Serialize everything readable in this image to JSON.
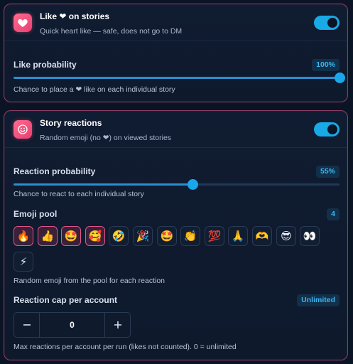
{
  "like_card": {
    "title": "Like ❤ on stories",
    "subtitle": "Quick heart like — safe, does not go to DM",
    "enabled": true,
    "prob_label": "Like probability",
    "prob_value": "100%",
    "prob_fraction": 1.0,
    "prob_help": "Chance to place a ❤ like on each individual story"
  },
  "reactions_card": {
    "title": "Story reactions",
    "subtitle": "Random emoji (no ❤) on viewed stories",
    "enabled": true,
    "prob_label": "Reaction probability",
    "prob_value": "55%",
    "prob_fraction": 0.55,
    "prob_help": "Chance to react to each individual story",
    "pool_label": "Emoji pool",
    "pool_count": "4",
    "emojis": [
      {
        "char": "🔥",
        "selected": true
      },
      {
        "char": "👍",
        "selected": true
      },
      {
        "char": "🤩",
        "selected": true
      },
      {
        "char": "🥰",
        "selected": true
      },
      {
        "char": "🤣",
        "selected": false
      },
      {
        "char": "🎉",
        "selected": false
      },
      {
        "char": "🤩",
        "selected": false
      },
      {
        "char": "👏",
        "selected": false
      },
      {
        "char": "💯",
        "selected": false
      },
      {
        "char": "🙏",
        "selected": false
      },
      {
        "char": "🫶",
        "selected": false
      },
      {
        "char": "😎",
        "selected": false
      },
      {
        "char": "👀",
        "selected": false
      },
      {
        "char": "⚡",
        "selected": false
      }
    ],
    "pool_help": "Random emoji from the pool for each reaction",
    "cap_label": "Reaction cap per account",
    "cap_badge": "Unlimited",
    "cap_value": "0",
    "cap_help": "Max reactions per account per run (likes not counted). 0 = unlimited"
  },
  "colors": {
    "accent": "#19a9e6",
    "pink": "#e83f72",
    "background": "#0b1424"
  }
}
